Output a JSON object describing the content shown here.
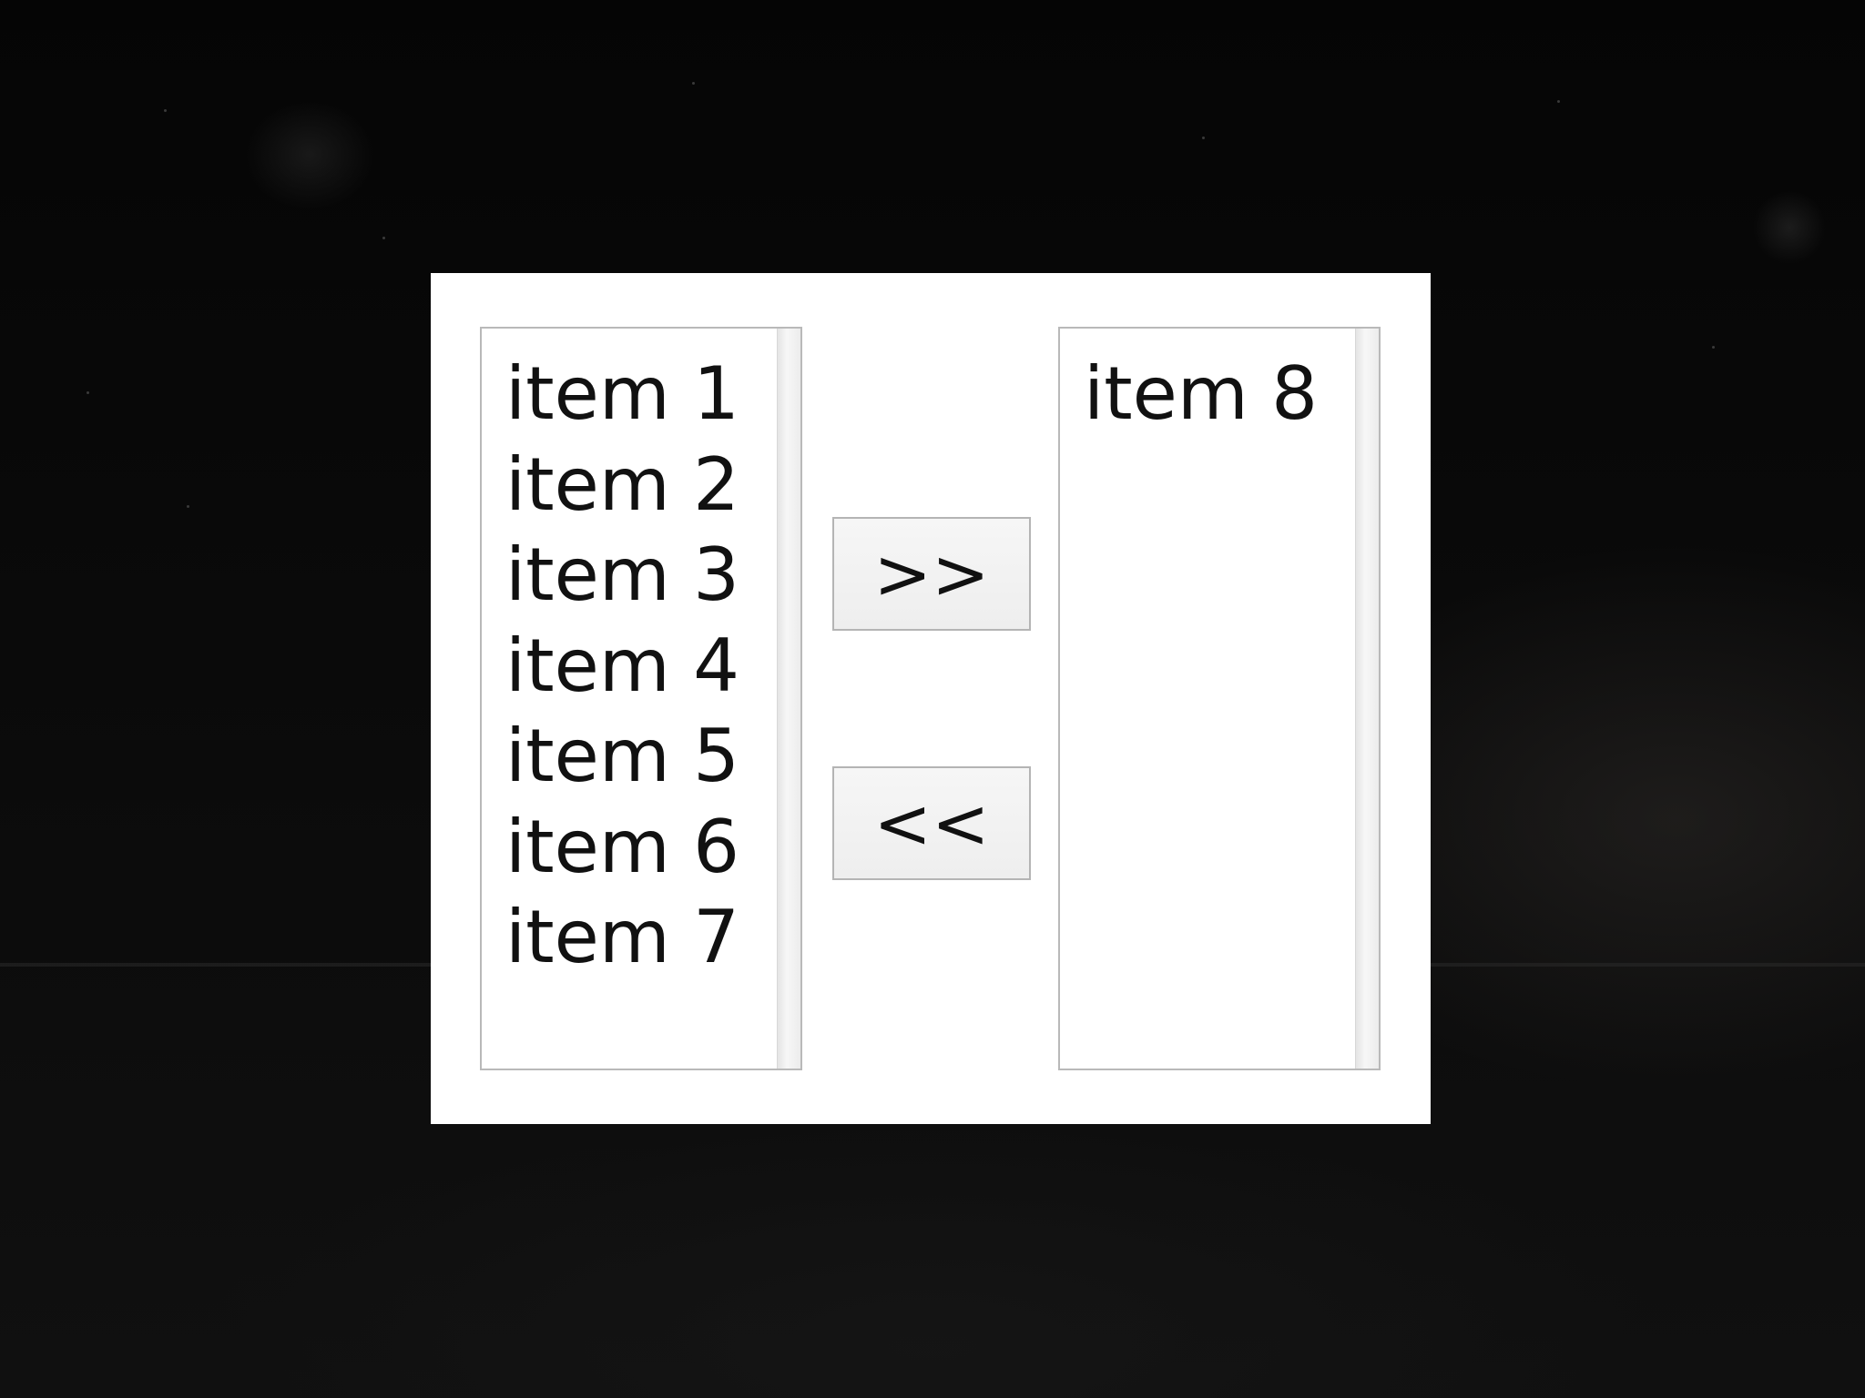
{
  "left_list": {
    "items": [
      "item 1",
      "item 2",
      "item 3",
      "item 4",
      "item 5",
      "item 6",
      "item 7"
    ]
  },
  "right_list": {
    "items": [
      "item 8"
    ]
  },
  "buttons": {
    "move_right_label": ">>",
    "move_left_label": "<<"
  }
}
